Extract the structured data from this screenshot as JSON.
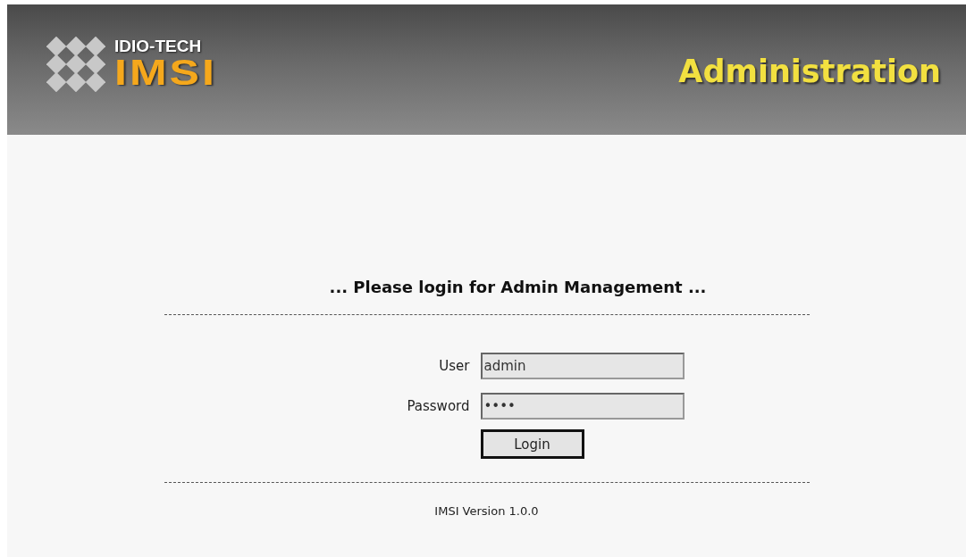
{
  "header": {
    "logo_top": "IDIO-TECH",
    "logo_main": "IMSI",
    "title": "Administration"
  },
  "login": {
    "heading": "... Please login for Admin Management ...",
    "fields": [
      {
        "label": "User",
        "value": "admin"
      },
      {
        "label": "Password",
        "value": "••••"
      }
    ],
    "button": "Login"
  },
  "footer": "IMSI Version 1.0.0"
}
